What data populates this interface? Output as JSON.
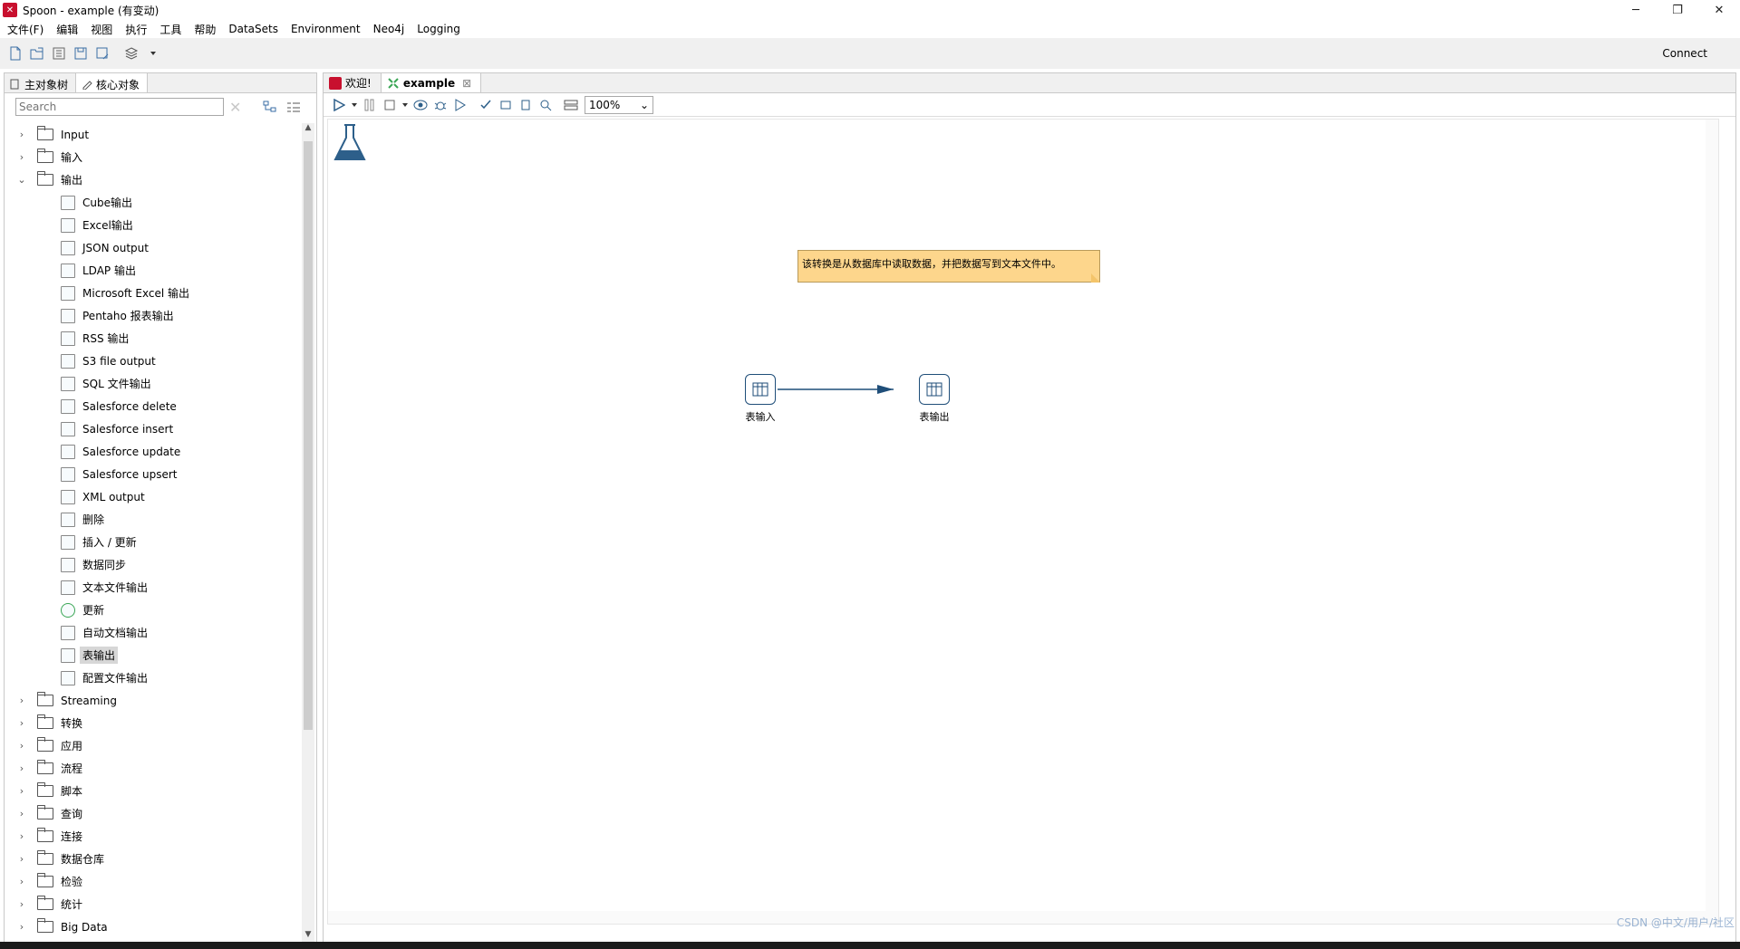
{
  "window": {
    "title": "Spoon - example (有变动)",
    "logo": "spoon-logo-icon"
  },
  "window_controls": {
    "minimize": "─",
    "restore": "❐",
    "close": "✕"
  },
  "menu": [
    "文件(F)",
    "编辑",
    "视图",
    "执行",
    "工具",
    "帮助",
    "DataSets",
    "Environment",
    "Neo4j",
    "Logging"
  ],
  "toolbar": {
    "connect_label": "Connect"
  },
  "left_panel": {
    "tabs": [
      "主对象树",
      "核心对象"
    ],
    "search_placeholder": "Search",
    "tree": {
      "input": "Input",
      "input_cn": "输入",
      "output_cn": "输出",
      "output_children": [
        "Cube输出",
        "Excel输出",
        "JSON output",
        "LDAP 输出",
        "Microsoft Excel 输出",
        "Pentaho 报表输出",
        "RSS 输出",
        "S3 file output",
        "SQL 文件输出",
        "Salesforce delete",
        "Salesforce insert",
        "Salesforce update",
        "Salesforce upsert",
        "XML output",
        "删除",
        "插入 / 更新",
        "数据同步",
        "文本文件输出",
        "更新",
        "自动文档输出",
        "表输出",
        "配置文件输出"
      ],
      "after": [
        "Streaming",
        "转换",
        "应用",
        "流程",
        "脚本",
        "查询",
        "连接",
        "数据仓库",
        "检验",
        "统计",
        "Big Data"
      ]
    }
  },
  "right_panel": {
    "tabs": [
      {
        "label": "欢迎!"
      },
      {
        "label": "example"
      }
    ],
    "zoom": "100%",
    "note_text": "该转换是从数据库中读取数据，并把数据写到文本文件中。",
    "steps": {
      "input": "表输入",
      "output": "表输出"
    }
  },
  "watermark": "CSDN @中文/用户/社区"
}
